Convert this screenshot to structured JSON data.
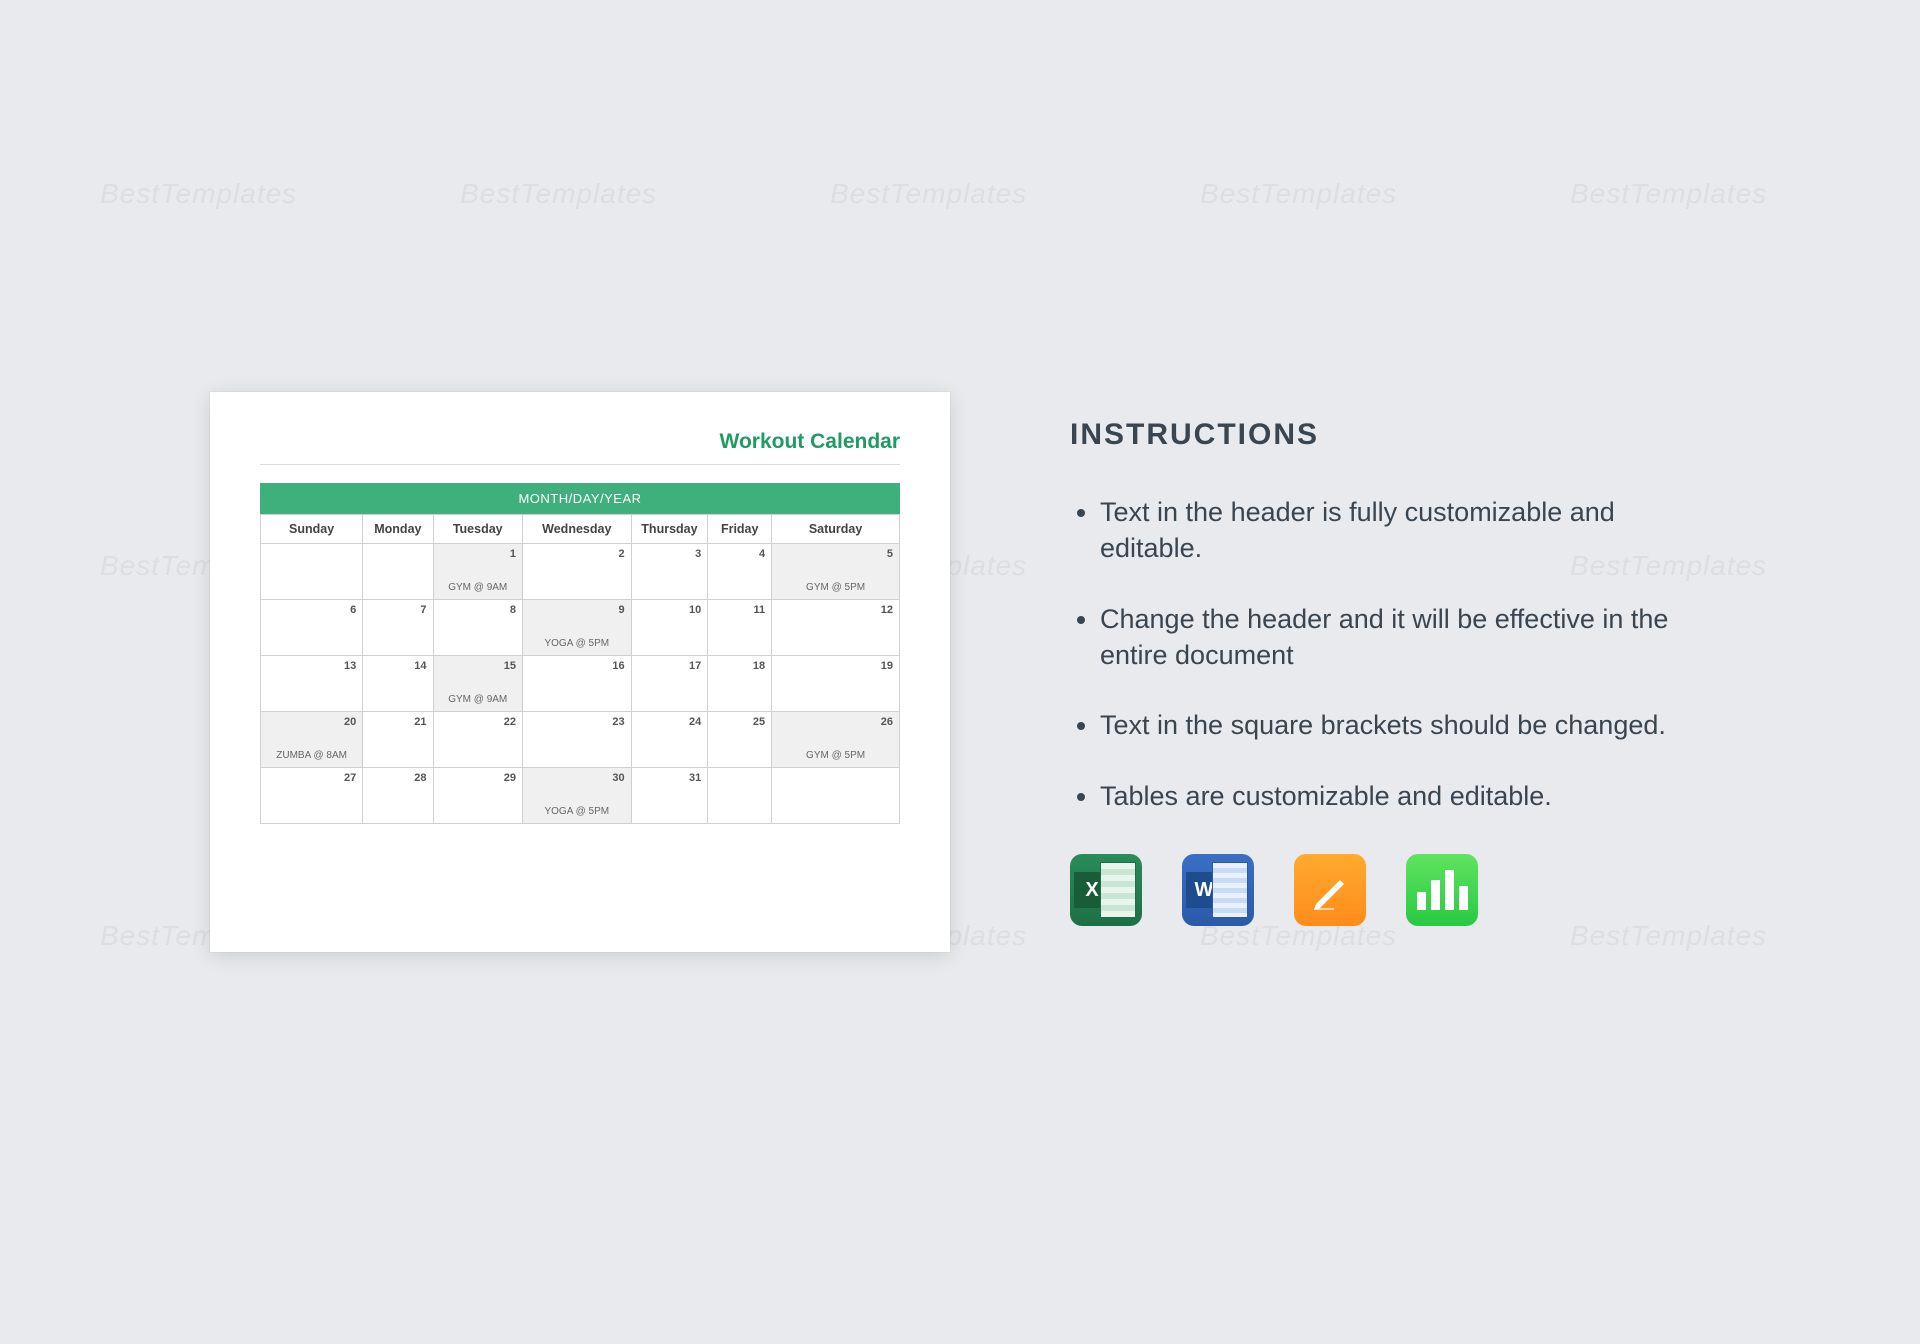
{
  "watermark": "BestTemplates",
  "preview": {
    "title": "Workout Calendar",
    "banner": "MONTH/DAY/YEAR",
    "days": [
      "Sunday",
      "Monday",
      "Tuesday",
      "Wednesday",
      "Thursday",
      "Friday",
      "Saturday"
    ],
    "rows": [
      [
        {
          "n": "",
          "shade": false,
          "evt": ""
        },
        {
          "n": "",
          "shade": false,
          "evt": ""
        },
        {
          "n": "1",
          "shade": true,
          "evt": "GYM @ 9AM"
        },
        {
          "n": "2",
          "shade": false,
          "evt": ""
        },
        {
          "n": "3",
          "shade": false,
          "evt": ""
        },
        {
          "n": "4",
          "shade": false,
          "evt": ""
        },
        {
          "n": "5",
          "shade": true,
          "evt": "GYM @ 5PM"
        }
      ],
      [
        {
          "n": "6",
          "shade": false,
          "evt": ""
        },
        {
          "n": "7",
          "shade": false,
          "evt": ""
        },
        {
          "n": "8",
          "shade": false,
          "evt": ""
        },
        {
          "n": "9",
          "shade": true,
          "evt": "YOGA @ 5PM"
        },
        {
          "n": "10",
          "shade": false,
          "evt": ""
        },
        {
          "n": "11",
          "shade": false,
          "evt": ""
        },
        {
          "n": "12",
          "shade": false,
          "evt": ""
        }
      ],
      [
        {
          "n": "13",
          "shade": false,
          "evt": ""
        },
        {
          "n": "14",
          "shade": false,
          "evt": ""
        },
        {
          "n": "15",
          "shade": true,
          "evt": "GYM @ 9AM"
        },
        {
          "n": "16",
          "shade": false,
          "evt": ""
        },
        {
          "n": "17",
          "shade": false,
          "evt": ""
        },
        {
          "n": "18",
          "shade": false,
          "evt": ""
        },
        {
          "n": "19",
          "shade": false,
          "evt": ""
        }
      ],
      [
        {
          "n": "20",
          "shade": true,
          "evt": "ZUMBA @ 8AM"
        },
        {
          "n": "21",
          "shade": false,
          "evt": ""
        },
        {
          "n": "22",
          "shade": false,
          "evt": ""
        },
        {
          "n": "23",
          "shade": false,
          "evt": ""
        },
        {
          "n": "24",
          "shade": false,
          "evt": ""
        },
        {
          "n": "25",
          "shade": false,
          "evt": ""
        },
        {
          "n": "26",
          "shade": true,
          "evt": "GYM @ 5PM"
        }
      ],
      [
        {
          "n": "27",
          "shade": false,
          "evt": ""
        },
        {
          "n": "28",
          "shade": false,
          "evt": ""
        },
        {
          "n": "29",
          "shade": false,
          "evt": ""
        },
        {
          "n": "30",
          "shade": true,
          "evt": "YOGA @ 5PM"
        },
        {
          "n": "31",
          "shade": false,
          "evt": ""
        },
        {
          "n": "",
          "shade": false,
          "evt": ""
        },
        {
          "n": "",
          "shade": false,
          "evt": ""
        }
      ]
    ]
  },
  "instructions": {
    "title": "INSTRUCTIONS",
    "items": [
      "Text in the header is fully customizable and editable.",
      "Change the header and it will be effective in the entire document",
      "Text in the square brackets should be changed.",
      "Tables are customizable and editable."
    ]
  },
  "apps": {
    "excel": "X",
    "word": "W"
  }
}
